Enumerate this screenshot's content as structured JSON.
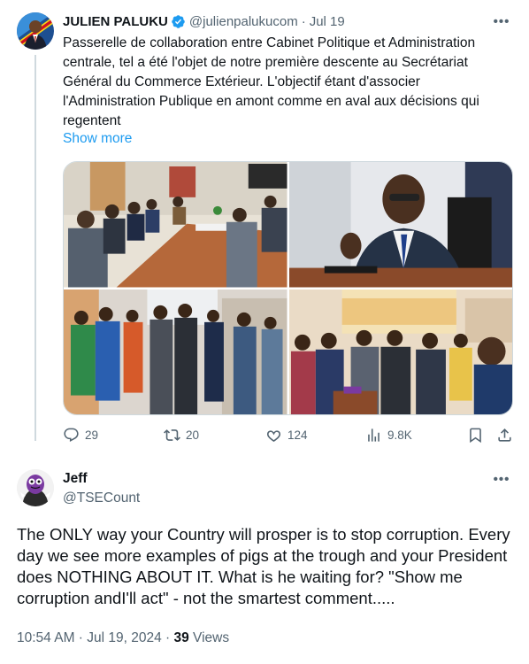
{
  "parent": {
    "name": "JULIEN PALUKU",
    "handle": "@julienpalukucom",
    "separator": "·",
    "date": "Jul 19",
    "text": "Passerelle de collaboration entre Cabinet Politique et Administration centrale, tel a été l'objet de notre première descente au Secrétariat Général du Commerce Extérieur. L'objectif étant d'associer l'Administration Publique en amont comme en aval aux décisions qui regentent",
    "show_more": "Show more",
    "stats": {
      "replies": "29",
      "retweets": "20",
      "likes": "124",
      "views": "9.8K"
    }
  },
  "reply": {
    "name": "Jeff",
    "handle": "@TSECount",
    "text": "The ONLY way your Country will prosper is to stop corruption. Every day we see more examples of pigs at the trough and your President does NOTHING ABOUT IT. What is he waiting for? \"Show me corruption andI'll act\" - not the smartest comment.....",
    "timestamp": "10:54 AM · Jul 19, 2024 · ",
    "views_count": "39",
    "views_label": " Views"
  },
  "icons": {
    "verified": "verified-badge-icon",
    "more": "more-options-icon",
    "reply": "reply-icon",
    "retweet": "retweet-icon",
    "like": "heart-icon",
    "views": "views-chart-icon",
    "bookmark": "bookmark-icon",
    "share": "share-icon"
  },
  "colors": {
    "accent": "#1d9bf0",
    "text": "#0f1419",
    "muted": "#536471",
    "line": "#cfd9de"
  }
}
